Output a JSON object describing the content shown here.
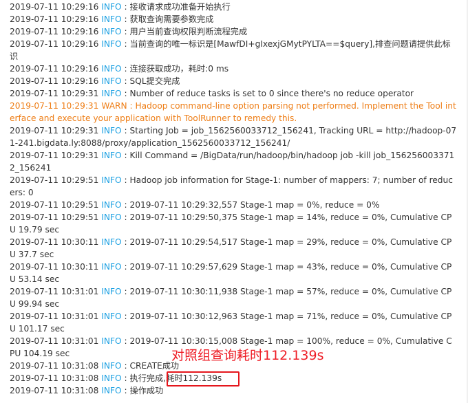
{
  "log": {
    "entries": [
      {
        "ts": "2019-07-11 10:29:16",
        "level": "INFO",
        "sep": " : ",
        "msg": "接收请求成功准备开始执行"
      },
      {
        "ts": "2019-07-11 10:29:16",
        "level": "INFO",
        "sep": " : ",
        "msg": "获取查询需要参数完成"
      },
      {
        "ts": "2019-07-11 10:29:16",
        "level": "INFO",
        "sep": " : ",
        "msg": "用户当前查询权限判断流程完成"
      },
      {
        "ts": "2019-07-11 10:29:16",
        "level": "INFO",
        "sep": " : ",
        "msg": "当前查询的唯一标识是[MawfDI+gIxexjGMytPYLTA==$query],排查问题请提供此标识"
      },
      {
        "ts": "2019-07-11 10:29:16",
        "level": "INFO",
        "sep": " : ",
        "msg": "连接获取成功，耗时:0 ms"
      },
      {
        "ts": "2019-07-11 10:29:16",
        "level": "INFO",
        "sep": " : ",
        "msg": "SQL提交完成"
      },
      {
        "ts": "2019-07-11 10:29:31",
        "level": "INFO",
        "sep": " : ",
        "msg": "Number of reduce tasks is set to 0 since there's no reduce operator"
      },
      {
        "ts": "2019-07-11 10:29:31",
        "level": "WARN",
        "sep": " : ",
        "msg": "Hadoop command-line option parsing not performed. Implement the Tool interface and execute your application with ToolRunner to remedy this."
      },
      {
        "ts": "2019-07-11 10:29:31",
        "level": "INFO",
        "sep": " : ",
        "msg": "Starting Job = job_1562560033712_156241, Tracking URL = http://hadoop-071-241.bigdata.ly:8088/proxy/application_1562560033712_156241/"
      },
      {
        "ts": "2019-07-11 10:29:31",
        "level": "INFO",
        "sep": " : ",
        "msg": "Kill Command = /BigData/run/hadoop/bin/hadoop job -kill job_1562560033712_156241"
      },
      {
        "ts": "2019-07-11 10:29:51",
        "level": "INFO",
        "sep": " : ",
        "msg": "Hadoop job information for Stage-1: number of mappers: 7; number of reducers: 0"
      },
      {
        "ts": "2019-07-11 10:29:51",
        "level": "INFO",
        "sep": " : ",
        "msg": "2019-07-11 10:29:32,557 Stage-1 map = 0%, reduce = 0%"
      },
      {
        "ts": "2019-07-11 10:29:51",
        "level": "INFO",
        "sep": " : ",
        "msg": "2019-07-11 10:29:50,375 Stage-1 map = 14%, reduce = 0%, Cumulative CPU 19.79 sec"
      },
      {
        "ts": "2019-07-11 10:30:11",
        "level": "INFO",
        "sep": " : ",
        "msg": "2019-07-11 10:29:54,517 Stage-1 map = 29%, reduce = 0%, Cumulative CPU 37.7 sec"
      },
      {
        "ts": "2019-07-11 10:30:11",
        "level": "INFO",
        "sep": " : ",
        "msg": "2019-07-11 10:29:57,629 Stage-1 map = 43%, reduce = 0%, Cumulative CPU 53.14 sec"
      },
      {
        "ts": "2019-07-11 10:31:01",
        "level": "INFO",
        "sep": " : ",
        "msg": "2019-07-11 10:30:11,938 Stage-1 map = 57%, reduce = 0%, Cumulative CPU 99.94 sec"
      },
      {
        "ts": "2019-07-11 10:31:01",
        "level": "INFO",
        "sep": " : ",
        "msg": "2019-07-11 10:30:12,963 Stage-1 map = 71%, reduce = 0%, Cumulative CPU 101.17 sec"
      },
      {
        "ts": "2019-07-11 10:31:01",
        "level": "INFO",
        "sep": " : ",
        "msg": "2019-07-11 10:30:15,008 Stage-1 map = 100%, reduce = 0%, Cumulative CPU 104.19 sec"
      },
      {
        "ts": "2019-07-11 10:31:08",
        "level": "INFO",
        "sep": " : ",
        "msg": "CREATE成功"
      },
      {
        "ts": "2019-07-11 10:31:08",
        "level": "INFO",
        "sep": " : ",
        "msg": "执行完成,耗时112.139s"
      },
      {
        "ts": "2019-07-11 10:31:08",
        "level": "INFO",
        "sep": " : ",
        "msg": "操作成功"
      }
    ]
  },
  "annotation": {
    "text": "对照组查询耗时112.139s"
  },
  "colors": {
    "info": "#1ba0e2",
    "warn": "#ee7d15",
    "text": "#333333",
    "annotation": "#ee1c25"
  }
}
